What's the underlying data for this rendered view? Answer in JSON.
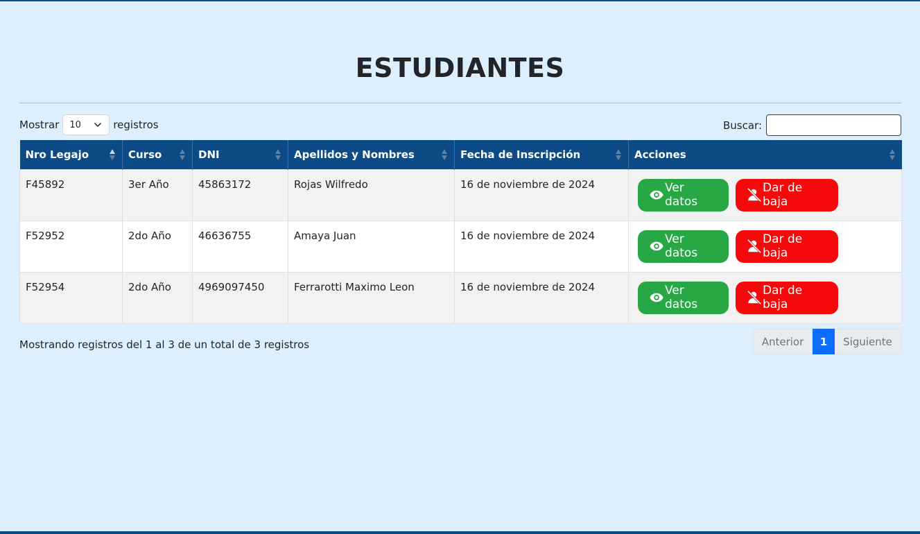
{
  "page": {
    "title": "ESTUDIANTES"
  },
  "length": {
    "prefix": "Mostrar",
    "value": "10",
    "suffix": "registros"
  },
  "search": {
    "label": "Buscar:",
    "value": ""
  },
  "table": {
    "columns": [
      "Nro Legajo",
      "Curso",
      "DNI",
      "Apellidos y Nombres",
      "Fecha de Inscripción",
      "Acciones"
    ],
    "rows": [
      {
        "legajo": "F45892",
        "curso": "3er Año",
        "dni": "45863172",
        "nombre": "Rojas Wilfredo",
        "fecha": "16 de noviembre de 2024"
      },
      {
        "legajo": "F52952",
        "curso": "2do Año",
        "dni": "46636755",
        "nombre": "Amaya Juan",
        "fecha": "16 de noviembre de 2024"
      },
      {
        "legajo": "F52954",
        "curso": "2do Año",
        "dni": "4969097450",
        "nombre": "Ferrarotti Maximo Leon",
        "fecha": "16 de noviembre de 2024"
      }
    ],
    "actions": {
      "view_label": "Ver datos",
      "drop_label": "Dar de baja"
    }
  },
  "info": "Mostrando registros del 1 al 3 de un total de 3 registros",
  "pagination": {
    "prev": "Anterior",
    "current": "1",
    "next": "Siguiente"
  },
  "colors": {
    "header": "#0d4b86",
    "background": "#ddeefc",
    "view": "#28a745",
    "drop": "#f40a0a",
    "page_active": "#0d6efd"
  },
  "icons": {
    "view": "eye-icon",
    "drop": "user-slash-icon",
    "sort": "sort-icon",
    "select": "chevron-down-icon"
  }
}
